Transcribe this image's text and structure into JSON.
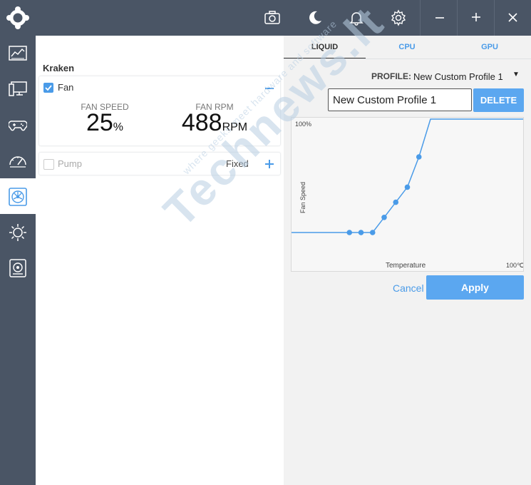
{
  "colors": {
    "chrome": "#4a5565",
    "accent": "#4a9be8",
    "button": "#5ba7f0",
    "panel": "#f2f2f2"
  },
  "topbar": {
    "icons": [
      "camera-icon",
      "moon-icon",
      "bell-icon",
      "gear-icon"
    ],
    "window_buttons": [
      "minimize",
      "maximize",
      "close"
    ]
  },
  "sidebar": {
    "items": [
      {
        "icon": "dashboard-icon",
        "active": false
      },
      {
        "icon": "monitor-icon",
        "active": false
      },
      {
        "icon": "gamepad-icon",
        "active": false
      },
      {
        "icon": "speedometer-icon",
        "active": false
      },
      {
        "icon": "fan-cooling-icon",
        "active": true
      },
      {
        "icon": "sun-lighting-icon",
        "active": false
      },
      {
        "icon": "storage-drive-icon",
        "active": false
      }
    ]
  },
  "left": {
    "device_title": "Kraken",
    "fan": {
      "label": "Fan",
      "checked": true,
      "speed_label": "FAN SPEED",
      "speed_value": "25",
      "speed_unit": "%",
      "rpm_label": "FAN RPM",
      "rpm_value": "488",
      "rpm_unit": "RPM"
    },
    "pump": {
      "label": "Pump",
      "checked": false,
      "mode": "Fixed"
    }
  },
  "right": {
    "tabs": [
      {
        "label": "LIQUID",
        "active": true
      },
      {
        "label": "CPU",
        "active": false
      },
      {
        "label": "GPU",
        "active": false
      }
    ],
    "profile_label": "PROFILE:",
    "profile_selected": "New Custom Profile 1",
    "profile_name_value": "New Custom Profile 1",
    "delete_label": "DELETE",
    "cancel_label": "Cancel",
    "apply_label": "Apply"
  },
  "chart_data": {
    "type": "line",
    "xlabel": "Temperature",
    "ylabel": "Fan Speed",
    "x_max_label": "100℃",
    "y_max_label": "100%",
    "xlim": [
      0,
      100
    ],
    "ylim": [
      0,
      100
    ],
    "grid": false,
    "series": [
      {
        "points": [
          [
            0,
            25
          ],
          [
            25,
            25
          ],
          [
            30,
            25
          ],
          [
            35,
            25
          ],
          [
            40,
            35
          ],
          [
            45,
            45
          ],
          [
            50,
            55
          ],
          [
            55,
            75
          ],
          [
            60,
            100
          ],
          [
            100,
            100
          ]
        ],
        "markers": [
          [
            25,
            25
          ],
          [
            30,
            25
          ],
          [
            35,
            25
          ],
          [
            40,
            35
          ],
          [
            45,
            45
          ],
          [
            50,
            55
          ],
          [
            55,
            75
          ]
        ]
      }
    ]
  },
  "watermark": {
    "brand": "Technews.lt",
    "tagline": "where geeks meet hardware and software"
  }
}
